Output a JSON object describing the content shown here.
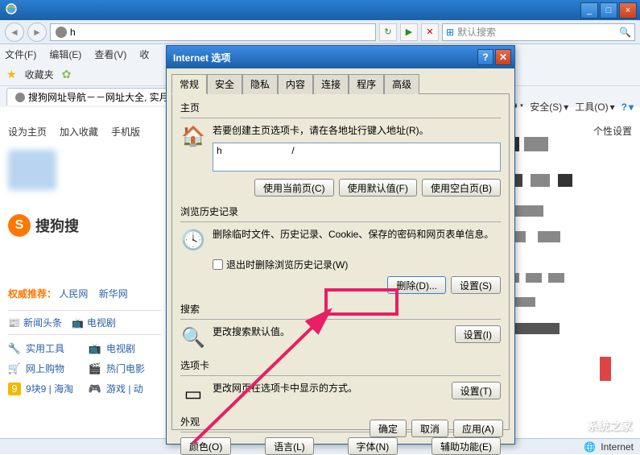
{
  "browser": {
    "titlebar": {
      "min": "_",
      "max": "□",
      "close": "×"
    },
    "addr_value": "h",
    "search_placeholder": "默认搜索",
    "menus": [
      "文件(F)",
      "编辑(E)",
      "查看(V)",
      "收"
    ],
    "fav_label": "收藏夹",
    "tab_title": "搜狗网址导航－－网址大全, 实月",
    "toolbar_items": {
      "safe": "安全(S)",
      "tools": "工具(O)",
      "help": "?"
    },
    "status_text": "Internet"
  },
  "page": {
    "nav": [
      "设为主页",
      "加入收藏",
      "手机版"
    ],
    "personal": "个性设置",
    "sogou": "搜狗搜",
    "rec_label": "权威推荐：",
    "rec_items": [
      "人民网",
      "新华网"
    ],
    "cats": [
      {
        "icon": "📰",
        "label": "新闻头条"
      },
      {
        "icon": "📺",
        "label": "电视剧"
      }
    ],
    "links": [
      {
        "icon": "🔧",
        "label": "实用工具",
        "color": "#4a90d0"
      },
      {
        "icon": "📺",
        "label": "电视剧",
        "color": "#888"
      },
      {
        "icon": "🛒",
        "label": "网上购物",
        "color": "#4a90d0"
      },
      {
        "icon": "🎬",
        "label": "热门电影",
        "color": "#888"
      },
      {
        "icon": "9",
        "label": "9块9 | 海淘",
        "color": "#f5b800"
      },
      {
        "icon": "🎮",
        "label": "游戏 | 动",
        "color": "#888"
      }
    ]
  },
  "dialog": {
    "title": "Internet 选项",
    "tabs": [
      "常规",
      "安全",
      "隐私",
      "内容",
      "连接",
      "程序",
      "高级"
    ],
    "home": {
      "title": "主页",
      "desc": "若要创建主页选项卡，请在各地址行键入地址(R)。",
      "url_value": "h                          /",
      "btn_current": "使用当前页(C)",
      "btn_default": "使用默认值(F)",
      "btn_blank": "使用空白页(B)"
    },
    "history": {
      "title": "浏览历史记录",
      "desc": "删除临时文件、历史记录、Cookie、保存的密码和网页表单信息。",
      "chk_label": "退出时删除浏览历史记录(W)",
      "btn_delete": "删除(D)...",
      "btn_settings": "设置(S)"
    },
    "search": {
      "title": "搜索",
      "desc": "更改搜索默认值。",
      "btn_settings": "设置(I)"
    },
    "tabopt": {
      "title": "选项卡",
      "desc": "更改网页在选项卡中显示的方式。",
      "btn_settings": "设置(T)"
    },
    "look": {
      "title": "外观",
      "btn_color": "颜色(O)",
      "btn_lang": "语言(L)",
      "btn_font": "字体(N)",
      "btn_access": "辅助功能(E)"
    },
    "footer": {
      "ok": "确定",
      "cancel": "取消",
      "apply": "应用(A)"
    }
  },
  "watermark": "系统之家"
}
